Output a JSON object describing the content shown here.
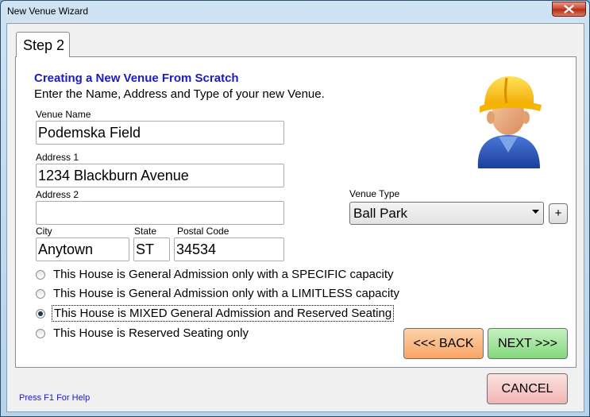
{
  "window": {
    "title": "New Venue Wizard",
    "close_icon": "close-icon"
  },
  "tab": {
    "label": "Step 2"
  },
  "header": {
    "heading": "Creating a New Venue From Scratch",
    "subheading": "Enter the Name, Address and Type of your new Venue."
  },
  "form": {
    "venue_name": {
      "label": "Venue Name",
      "value": "Podemska Field"
    },
    "address1": {
      "label": "Address 1",
      "value": "1234 Blackburn Avenue"
    },
    "address2": {
      "label": "Address 2",
      "value": ""
    },
    "city": {
      "label": "City",
      "value": "Anytown"
    },
    "state": {
      "label": "State",
      "value": "ST"
    },
    "postal": {
      "label": "Postal Code",
      "value": "34534"
    },
    "venue_type": {
      "label": "Venue Type",
      "value": "Ball Park",
      "add_label": "+"
    }
  },
  "options": [
    {
      "label": "This House is General Admission only with a SPECIFIC capacity",
      "checked": false
    },
    {
      "label": "This House is General Admission only with a LIMITLESS capacity",
      "checked": false
    },
    {
      "label": "This House is MIXED General Admission and Reserved Seating",
      "checked": true
    },
    {
      "label": "This House is Reserved Seating only",
      "checked": false
    }
  ],
  "buttons": {
    "back": "<<< BACK",
    "next": "NEXT >>>",
    "cancel": "CANCEL"
  },
  "help": "Press F1 For Help",
  "icons": {
    "avatar": "construction-worker-icon",
    "dropdown": "chevron-down-icon"
  }
}
